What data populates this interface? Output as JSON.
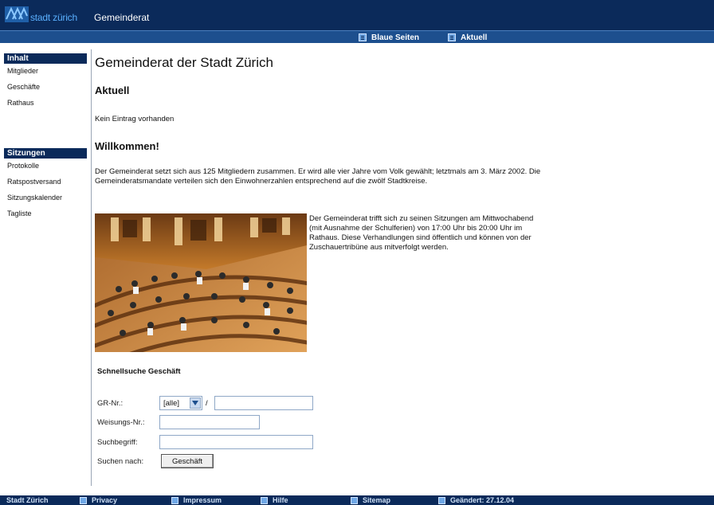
{
  "header": {
    "brand": "stadt zürich",
    "site_name": "Gemeinderat"
  },
  "subnav": [
    {
      "label": "Blaue Seiten",
      "icon": "page-icon"
    },
    {
      "label": "Aktuell",
      "icon": "page-icon"
    }
  ],
  "sidebar": {
    "sections": [
      {
        "title": "Inhalt",
        "items": [
          "Mitglieder",
          "Geschäfte",
          "Rathaus"
        ]
      },
      {
        "title": "Sitzungen",
        "items": [
          "Protokolle",
          "Ratspostversand",
          "Sitzungskalender",
          "Tagliste"
        ]
      }
    ]
  },
  "main": {
    "title": "Gemeinderat der Stadt Zürich",
    "aktuell_heading": "Aktuell",
    "aktuell_text": "Kein Eintrag vorhanden",
    "welcome_heading": "Willkommen!",
    "intro": "Der Gemeinderat setzt sich aus 125 Mitgliedern zusammen. Er wird alle vier Jahre vom Volk gewählt; letztmals am 3. März 2002. Die Gemeinderatsmandate verteilen sich den Einwohnerzahlen entsprechend auf die zwölf Stadtkreise.",
    "photo_caption": "Der Gemeinderat trifft sich zu seinen Sitzungen am Mittwochabend (mit Ausnahme der Schulferien) von 17:00 Uhr bis 20:00 Uhr im Rathaus. Diese Verhandlungen sind öffentlich und können von der Zuschauertribüne aus mitverfolgt werden."
  },
  "search": {
    "title": "Schnellsuche Geschäft",
    "gr_label": "GR-Nr.:",
    "gr_select_value": "[alle]",
    "gr_separator": "/",
    "gr_value": "",
    "weisung_label": "Weisungs-Nr.:",
    "weisung_value": "",
    "begriff_label": "Suchbegriff:",
    "begriff_value": "",
    "search_for_label": "Suchen nach:",
    "button_label": "Geschäft"
  },
  "footer": {
    "home": "Stadt Zürich",
    "items": [
      "Privacy",
      "Impressum",
      "Hilfe",
      "Sitemap"
    ],
    "changed": "Geändert: 27.12.04"
  },
  "colors": {
    "header_bg": "#0b2a5a",
    "subnav_bg": "#1d4f8e",
    "brand_text": "#5ab0ff"
  }
}
